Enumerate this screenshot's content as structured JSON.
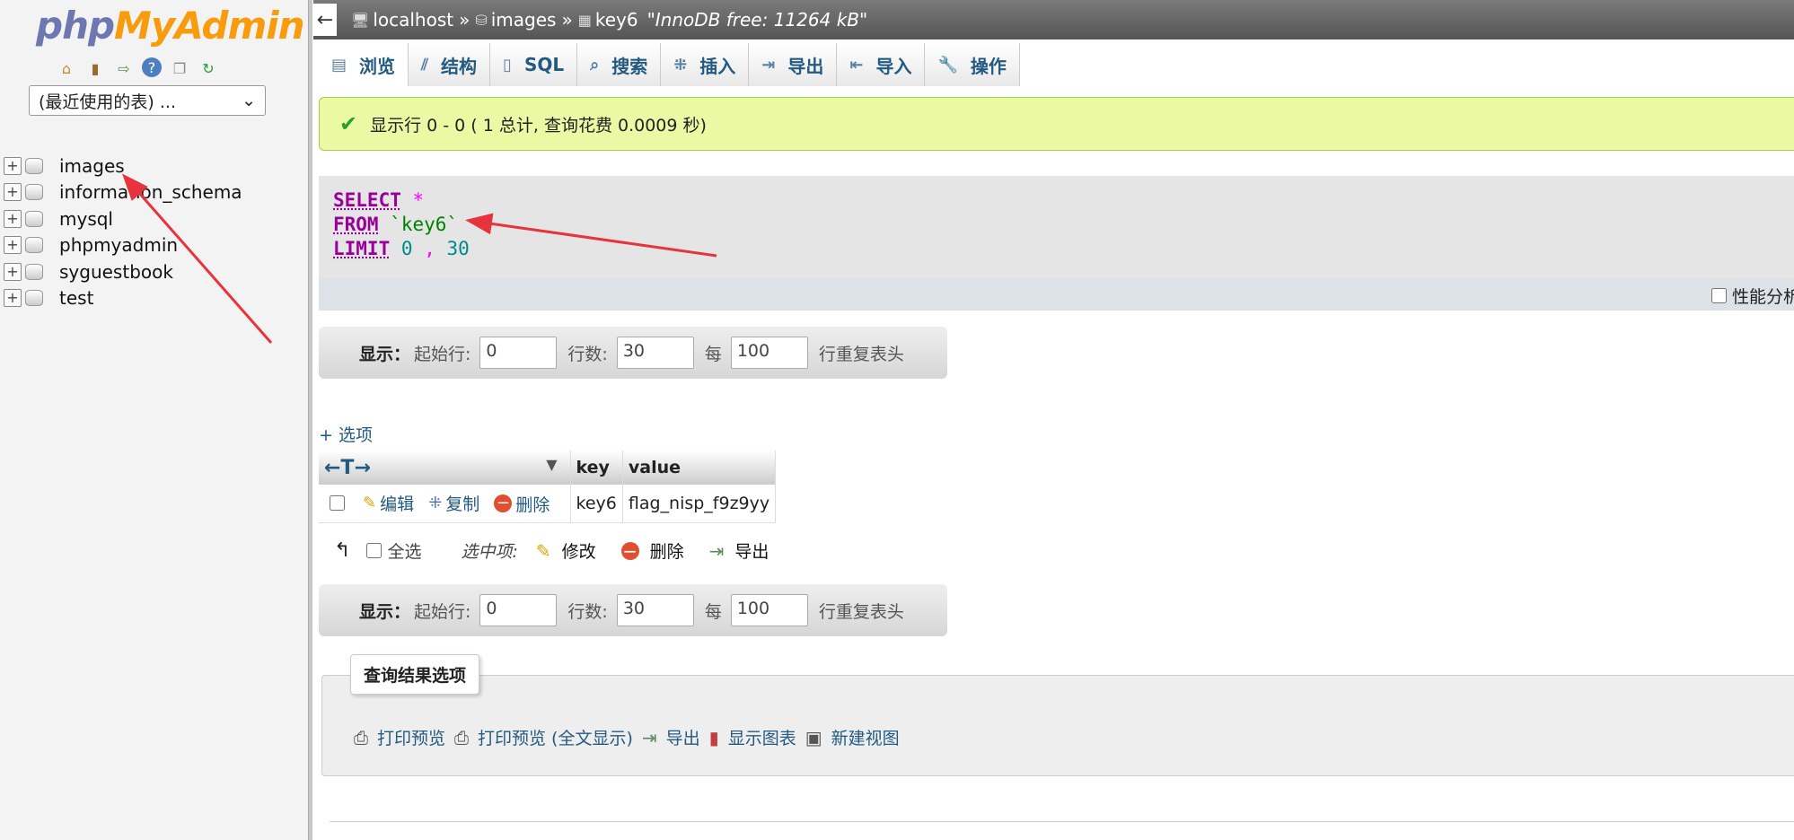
{
  "nav": {
    "logo_php": "php",
    "logo_myadmin": "MyAdmin",
    "icons": [
      "home-icon",
      "exit-icon",
      "sql-query-icon",
      "help-icon",
      "docs-icon",
      "reload-icon"
    ],
    "recent_tables": "(最近使用的表) ...",
    "databases": [
      "images",
      "information_schema",
      "mysql",
      "phpmyadmin",
      "syguestbook",
      "test"
    ]
  },
  "breadcrumb": {
    "server": "localhost",
    "database": "images",
    "table": "key6",
    "comment": "\"InnoDB free: 11264 kB\"",
    "separator": "»"
  },
  "tabs": [
    {
      "label": "浏览",
      "icon": "browse-icon"
    },
    {
      "label": "结构",
      "icon": "structure-icon"
    },
    {
      "label": "SQL",
      "icon": "sql-icon"
    },
    {
      "label": "搜索",
      "icon": "search-icon"
    },
    {
      "label": "插入",
      "icon": "insert-icon"
    },
    {
      "label": "导出",
      "icon": "export-icon"
    },
    {
      "label": "导入",
      "icon": "import-icon"
    },
    {
      "label": "操作",
      "icon": "operations-icon"
    }
  ],
  "message": "显示行 0 - 0 ( 1 总计, 查询花费 0.0009 秒)",
  "sql": {
    "select": "SELECT",
    "star": "*",
    "from": "FROM",
    "table": "`key6`",
    "limit": "LIMIT",
    "offset": "0",
    "comma": ",",
    "count": "30"
  },
  "profiling_label": "性能分析",
  "navform": {
    "show": "显示：",
    "start_label": "起始行:",
    "start_value": "0",
    "rows_label": "行数:",
    "rows_value": "30",
    "per_label": "每",
    "repeat_value": "100",
    "repeat_label": "行重复表头"
  },
  "options_link": "+ 选项",
  "table": {
    "arrows": "←T→",
    "columns": [
      "key",
      "value"
    ],
    "rows": [
      {
        "edit": "编辑",
        "copy": "复制",
        "delete": "删除",
        "key": "key6",
        "value": "flag_nisp_f9z9yy"
      }
    ]
  },
  "bulk": {
    "select_all": "全选",
    "with_selected": "选中项:",
    "modify": "修改",
    "delete": "删除",
    "export": "导出"
  },
  "query_ops": {
    "legend": "查询结果选项",
    "print": "打印预览",
    "print_full": "打印预览 (全文显示)",
    "export": "导出",
    "chart": "显示图表",
    "create_view": "新建视图"
  },
  "colors": {
    "link": "#235a81",
    "success_bg": "#ebf8a4",
    "sql_keyword": "#990099",
    "annotation_arrow": "#e8323c"
  }
}
